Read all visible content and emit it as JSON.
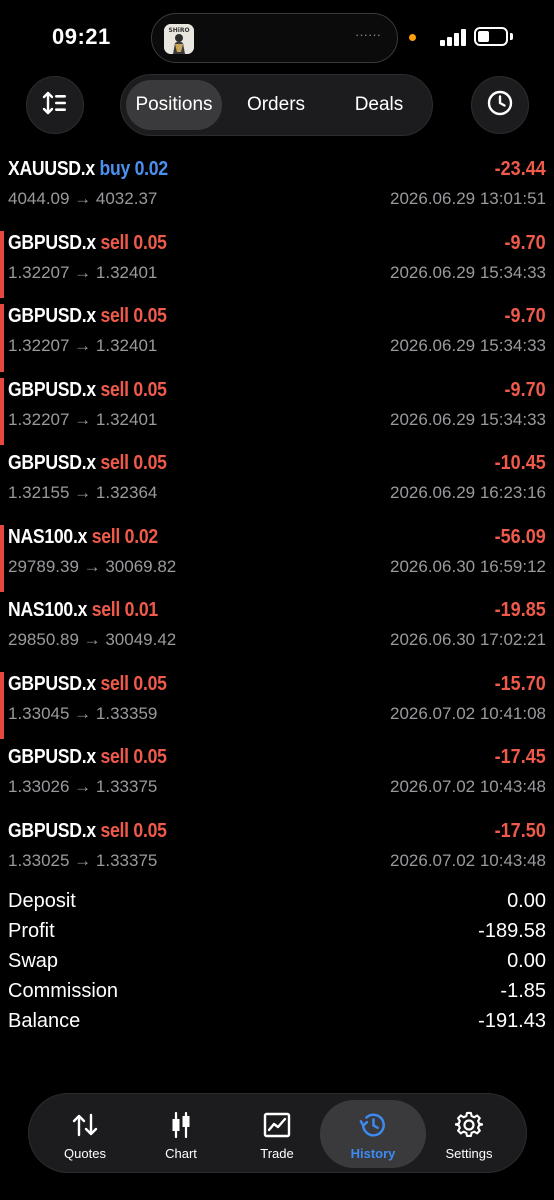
{
  "status_bar": {
    "time": "09:21",
    "island_dots": "······",
    "island_app_text": "SHiRO"
  },
  "header": {
    "sort_icon": "sort-arrows-icon",
    "history_time_icon": "clock-icon",
    "segments": [
      {
        "label": "Positions",
        "active": true
      },
      {
        "label": "Orders",
        "active": false
      },
      {
        "label": "Deals",
        "active": false
      }
    ]
  },
  "positions": [
    {
      "symbol": "XAUUSD.x",
      "side": "buy 0.02",
      "type": "buy",
      "profit": "-23.44",
      "prices": "4044.09 → 4032.37",
      "time": "2026.06.29 13:01:51",
      "accent": false
    },
    {
      "symbol": "GBPUSD.x",
      "side": "sell 0.05",
      "type": "sell",
      "profit": "-9.70",
      "prices": "1.32207 → 1.32401",
      "time": "2026.06.29 15:34:33",
      "accent": true
    },
    {
      "symbol": "GBPUSD.x",
      "side": "sell 0.05",
      "type": "sell",
      "profit": "-9.70",
      "prices": "1.32207 → 1.32401",
      "time": "2026.06.29 15:34:33",
      "accent": true
    },
    {
      "symbol": "GBPUSD.x",
      "side": "sell 0.05",
      "type": "sell",
      "profit": "-9.70",
      "prices": "1.32207 → 1.32401",
      "time": "2026.06.29 15:34:33",
      "accent": true
    },
    {
      "symbol": "GBPUSD.x",
      "side": "sell 0.05",
      "type": "sell",
      "profit": "-10.45",
      "prices": "1.32155 → 1.32364",
      "time": "2026.06.29 16:23:16",
      "accent": false
    },
    {
      "symbol": "NAS100.x",
      "side": "sell 0.02",
      "type": "sell",
      "profit": "-56.09",
      "prices": "29789.39 → 30069.82",
      "time": "2026.06.30 16:59:12",
      "accent": true
    },
    {
      "symbol": "NAS100.x",
      "side": "sell 0.01",
      "type": "sell",
      "profit": "-19.85",
      "prices": "29850.89 → 30049.42",
      "time": "2026.06.30 17:02:21",
      "accent": false
    },
    {
      "symbol": "GBPUSD.x",
      "side": "sell 0.05",
      "type": "sell",
      "profit": "-15.70",
      "prices": "1.33045 → 1.33359",
      "time": "2026.07.02 10:41:08",
      "accent": true
    },
    {
      "symbol": "GBPUSD.x",
      "side": "sell 0.05",
      "type": "sell",
      "profit": "-17.45",
      "prices": "1.33026 → 1.33375",
      "time": "2026.07.02 10:43:48",
      "accent": false
    },
    {
      "symbol": "GBPUSD.x",
      "side": "sell 0.05",
      "type": "sell",
      "profit": "-17.50",
      "prices": "1.33025 → 1.33375",
      "time": "2026.07.02 10:43:48",
      "accent": false
    }
  ],
  "summary": [
    {
      "label": "Deposit",
      "value": "0.00"
    },
    {
      "label": "Profit",
      "value": "-189.58"
    },
    {
      "label": "Swap",
      "value": "0.00"
    },
    {
      "label": "Commission",
      "value": "-1.85"
    },
    {
      "label": "Balance",
      "value": "-191.43"
    }
  ],
  "tabs": [
    {
      "label": "Quotes",
      "icon": "quotes-arrows-icon",
      "active": false
    },
    {
      "label": "Chart",
      "icon": "candlestick-chart-icon",
      "active": false
    },
    {
      "label": "Trade",
      "icon": "trade-chart-icon",
      "active": false
    },
    {
      "label": "History",
      "icon": "history-icon",
      "active": true
    },
    {
      "label": "Settings",
      "icon": "gear-icon",
      "active": false
    }
  ],
  "colors": {
    "background": "#000000",
    "loss_red": "#ef5a4b",
    "buy_blue": "#4a90f0",
    "active_tab_blue": "#3d8bf2",
    "accent_bar": "#e5483c"
  }
}
